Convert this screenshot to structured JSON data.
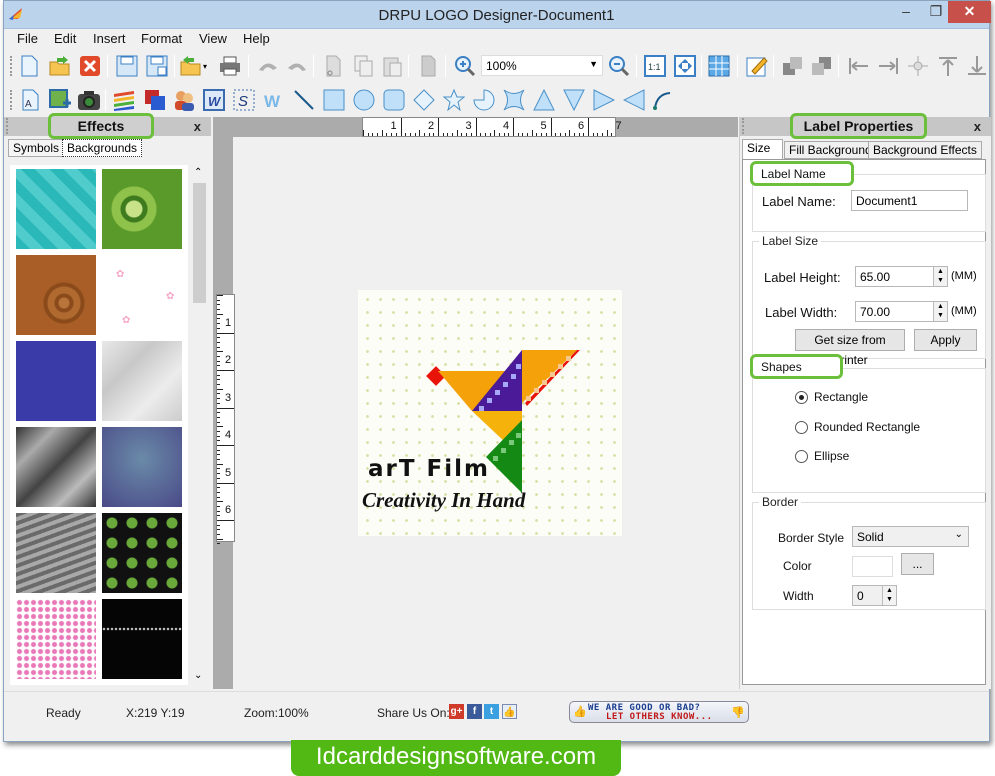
{
  "window": {
    "title": "DRPU LOGO Designer-Document1",
    "controls": {
      "minimize": "–",
      "restore": "❐",
      "close": "✕"
    }
  },
  "menu": [
    "File",
    "Edit",
    "Insert",
    "Format",
    "View",
    "Help"
  ],
  "toolbar1": {
    "zoom_value": "100%",
    "icons": [
      "new-document",
      "open-folder",
      "close-document",
      "save",
      "save-as",
      "export",
      "print",
      "undo",
      "redo",
      "cut",
      "copy",
      "paste",
      "delete",
      "zoom-in",
      "zoom-select",
      "zoom-out",
      "actual-size",
      "fit-to-window",
      "grid",
      "edit-properties",
      "bring-forward",
      "send-backward",
      "align-left",
      "align-right",
      "align-center",
      "align-top",
      "align-bottom"
    ]
  },
  "toolbar2": {
    "icons": [
      "text",
      "image",
      "camera",
      "layers",
      "shadow",
      "users",
      "word-art",
      "signature",
      "watermark",
      "line",
      "rectangle",
      "ellipse",
      "rounded-rectangle",
      "diamond",
      "star",
      "pie",
      "four-point-star",
      "triangle",
      "inverted-triangle",
      "right-triangle",
      "left-triangle",
      "arc"
    ]
  },
  "effects_panel": {
    "title": "Effects",
    "close": "x",
    "tabs": [
      "Symbols",
      "Backgrounds"
    ],
    "active_tab": "Backgrounds",
    "backgrounds": [
      {
        "name": "teal-geometric",
        "color": "#2bb8b8"
      },
      {
        "name": "green-circles",
        "color": "#5a9a2a"
      },
      {
        "name": "wood-grain",
        "color": "#9c5a24"
      },
      {
        "name": "pink-roses",
        "color": "#ffffff"
      },
      {
        "name": "blue-texture",
        "color": "#3a3aa8"
      },
      {
        "name": "white-marble",
        "color": "#d8d8d8"
      },
      {
        "name": "gray-silk",
        "color": "#6a6a6a"
      },
      {
        "name": "purple-droplets",
        "color": "#5a6a98"
      },
      {
        "name": "crumpled-gray",
        "color": "#8a8a8a"
      },
      {
        "name": "green-leaves",
        "color": "#111111"
      },
      {
        "name": "pink-flowers",
        "color": "#f4c8e0"
      },
      {
        "name": "black-lights",
        "color": "#0a0a0a"
      }
    ]
  },
  "canvas": {
    "hruler": [
      "1",
      "2",
      "3",
      "4",
      "5",
      "6",
      "7"
    ],
    "vruler": [
      "1",
      "2",
      "3",
      "4",
      "5",
      "6"
    ],
    "logo": {
      "title": "arT Film",
      "tagline": "Creativity In Hand"
    }
  },
  "properties_panel": {
    "title": "Label Properties",
    "close": "x",
    "tabs": [
      "Size",
      "Fill Background",
      "Background Effects"
    ],
    "active_tab": "Size",
    "label_name_group": "Label Name",
    "label_name_label": "Label Name:",
    "label_name_value": "Document1",
    "label_size_group": "Label Size",
    "height_label": "Label Height:",
    "height_value": "65.00",
    "width_label": "Label Width:",
    "width_value": "70.00",
    "unit": "(MM)",
    "get_size_button": "Get size from Printer",
    "apply_button": "Apply",
    "shapes_group": "Shapes",
    "shapes": [
      {
        "label": "Rectangle",
        "selected": true
      },
      {
        "label": "Rounded Rectangle",
        "selected": false
      },
      {
        "label": "Ellipse",
        "selected": false
      }
    ],
    "border_group": "Border",
    "border_style_label": "Border Style",
    "border_style_value": "Solid",
    "color_label": "Color",
    "color_button": "...",
    "width_label2": "Width",
    "border_width_value": "0"
  },
  "status": {
    "ready": "Ready",
    "coords": "X:219  Y:19",
    "zoom": "Zoom:100%",
    "share_label": "Share Us On:",
    "feedback_line1": "WE ARE GOOD OR BAD?",
    "feedback_line2": "LET OTHERS KNOW..."
  },
  "brand": {
    "text": "Idcarddesignsoftware.com"
  },
  "colors": {
    "highlight": "#6cbf3a",
    "brand_green": "#52b814",
    "title_bar": "#bcd3ec"
  }
}
